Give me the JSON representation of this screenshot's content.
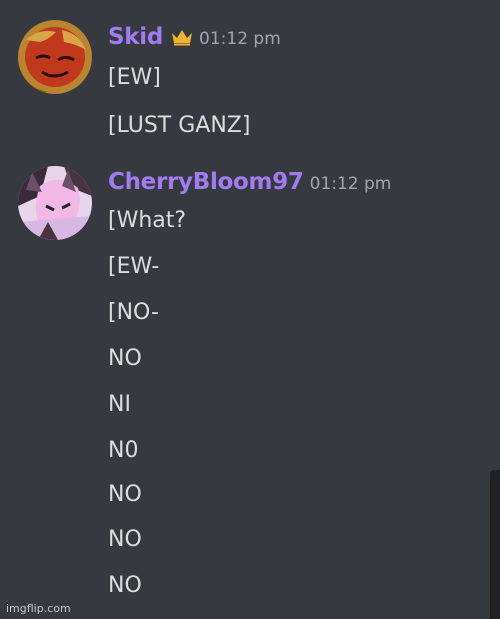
{
  "messages": [
    {
      "username": "Skid",
      "has_crown": true,
      "timestamp": "01:12 pm",
      "lines": [
        "[EW]",
        "[LUST GANZ]"
      ]
    },
    {
      "username": "CherryBloom97",
      "has_crown": false,
      "timestamp": "01:12 pm",
      "lines": [
        "[What?",
        "[EW-",
        "[NO-",
        "NO",
        "NI",
        "N0",
        "NO",
        "NO",
        "NO"
      ]
    }
  ],
  "colors": {
    "background": "#36393f",
    "username": "#a17bf0",
    "text": "#dcddde",
    "timestamp": "#a3a6aa",
    "crown": "#f0b232"
  },
  "watermark": "imgflip.com"
}
